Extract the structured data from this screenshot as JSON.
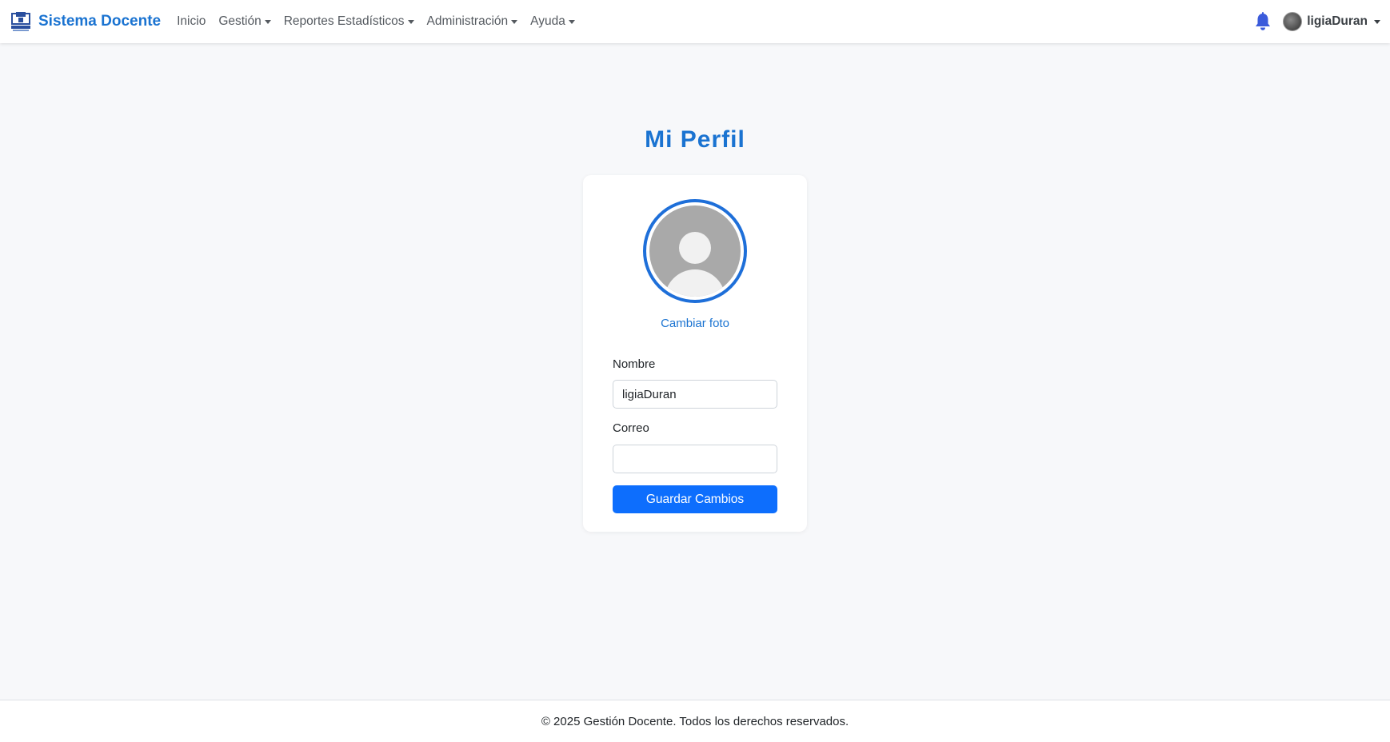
{
  "navbar": {
    "brand": "Sistema Docente",
    "items": [
      {
        "label": "Inicio",
        "dropdown": false
      },
      {
        "label": "Gestión",
        "dropdown": true
      },
      {
        "label": "Reportes Estadísticos",
        "dropdown": true
      },
      {
        "label": "Administración",
        "dropdown": true
      },
      {
        "label": "Ayuda",
        "dropdown": true
      }
    ],
    "notification_icon": "bell-icon",
    "user": {
      "name": "ligiaDuran"
    }
  },
  "main": {
    "title": "Mi Perfil",
    "change_photo": "Cambiar foto",
    "fields": {
      "nombre": {
        "label": "Nombre",
        "value": "ligiaDuran"
      },
      "correo": {
        "label": "Correo",
        "value": ""
      }
    },
    "save_button": "Guardar Cambios"
  },
  "footer": {
    "text": "© 2025 Gestión Docente. Todos los derechos reservados."
  },
  "colors": {
    "accent": "#1a73d1",
    "primary_button": "#0d6efd",
    "background": "#f7f8fa"
  }
}
